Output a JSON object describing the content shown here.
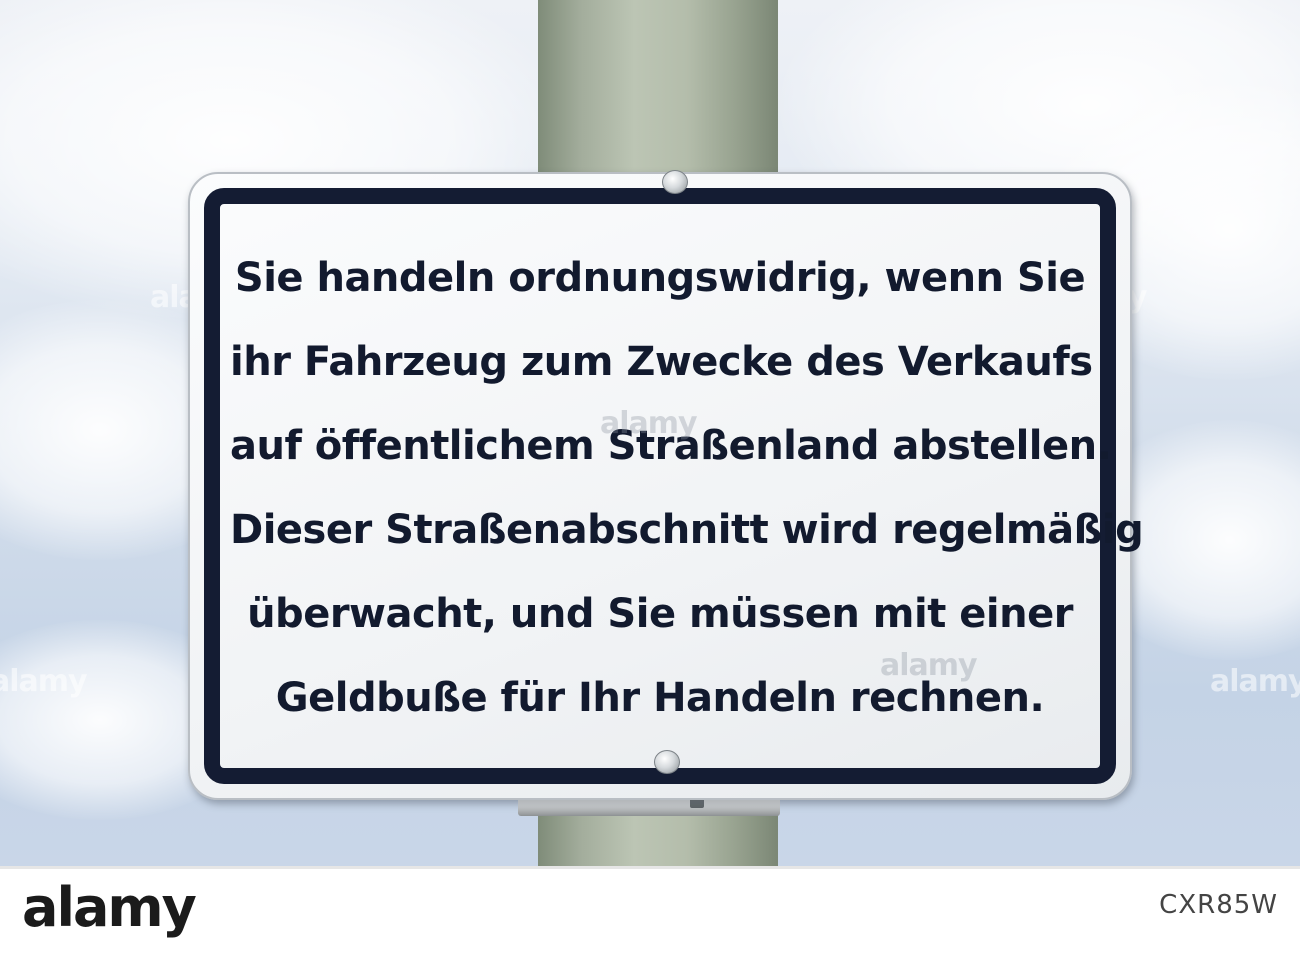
{
  "sign": {
    "lines": [
      "Sie handeln ordnungswidrig, wenn Sie",
      "ihr Fahrzeug zum Zwecke des Verkaufs",
      "auf öffentlichem Straßenland abstellen.",
      "Dieser Straßenabschnitt wird regelmäßig",
      "überwacht, und Sie müssen mit einer",
      "Geldbuße für Ihr Handeln rechnen."
    ],
    "text_color": "#121a2e",
    "border_color": "#141c33",
    "background_color": "#f4f6f8"
  },
  "pole": {
    "color": "#a9b3a1"
  },
  "sky": {
    "color": "#d2ddeb"
  },
  "watermark": {
    "text": "alamy"
  },
  "footer": {
    "logo": "alamy",
    "image_id": "CXR85W"
  }
}
